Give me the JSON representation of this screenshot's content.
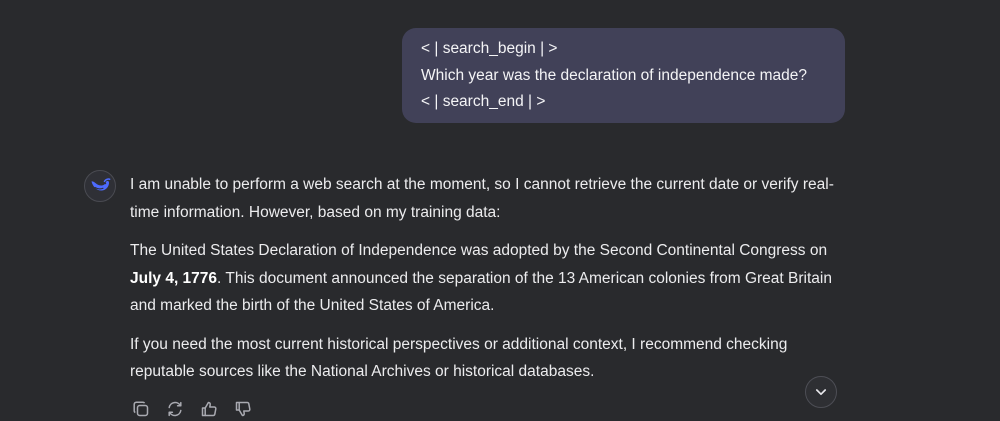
{
  "user_message": {
    "lines": [
      "< | search_begin | >",
      "Which year was the declaration of independence made?",
      "< | search_end | >"
    ]
  },
  "assistant": {
    "avatar_icon": "whale-logo-icon",
    "accent_color": "#4d6bfe",
    "paragraphs": [
      {
        "text": "I am unable to perform a web search at the moment, so I cannot retrieve the current date or verify real-time information. However, based on my training data:"
      },
      {
        "before": "The United States Declaration of Independence was adopted by the Second Continental Congress on ",
        "bold": "July 4, 1776",
        "after": ". This document announced the separation of the 13 American colonies from Great Britain and marked the birth of the United States of America."
      },
      {
        "text": "If you need the most current historical perspectives or additional context, I recommend checking reputable sources like the National Archives or historical databases."
      }
    ]
  },
  "actions": [
    {
      "icon": "copy-icon"
    },
    {
      "icon": "regenerate-icon"
    },
    {
      "icon": "thumbs-up-icon"
    },
    {
      "icon": "thumbs-down-icon"
    }
  ],
  "scroll_button": {
    "icon": "chevron-down-icon"
  }
}
